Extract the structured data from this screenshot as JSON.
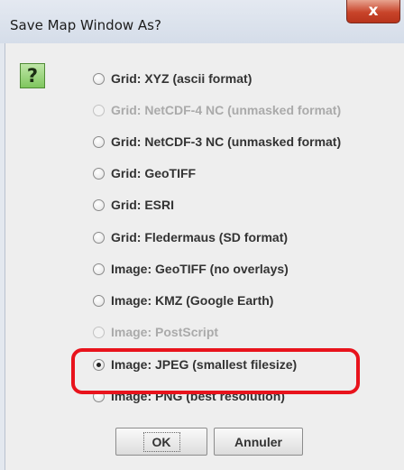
{
  "window": {
    "title": "Save Map Window As?",
    "close_label": "x"
  },
  "icon": {
    "symbol": "?",
    "name": "question-icon"
  },
  "options": [
    {
      "label": "Grid: XYZ (ascii format)",
      "enabled": true,
      "selected": false
    },
    {
      "label": "Grid: NetCDF-4 NC (unmasked format)",
      "enabled": false,
      "selected": false
    },
    {
      "label": "Grid: NetCDF-3 NC (unmasked format)",
      "enabled": true,
      "selected": false
    },
    {
      "label": "Grid: GeoTIFF",
      "enabled": true,
      "selected": false
    },
    {
      "label": "Grid: ESRI",
      "enabled": true,
      "selected": false
    },
    {
      "label": "Grid: Fledermaus (SD format)",
      "enabled": true,
      "selected": false
    },
    {
      "label": "Image: GeoTIFF (no overlays)",
      "enabled": true,
      "selected": false
    },
    {
      "label": "Image: KMZ (Google Earth)",
      "enabled": true,
      "selected": false
    },
    {
      "label": "Image: PostScript",
      "enabled": false,
      "selected": false
    },
    {
      "label": "Image: JPEG (smallest filesize)",
      "enabled": true,
      "selected": true
    },
    {
      "label": "Image: PNG (best resolution)",
      "enabled": true,
      "selected": false
    }
  ],
  "buttons": {
    "ok": "OK",
    "cancel": "Annuler"
  },
  "colors": {
    "highlight": "#e8131c",
    "close": "#c8442a",
    "icon": "#7fc65e"
  }
}
